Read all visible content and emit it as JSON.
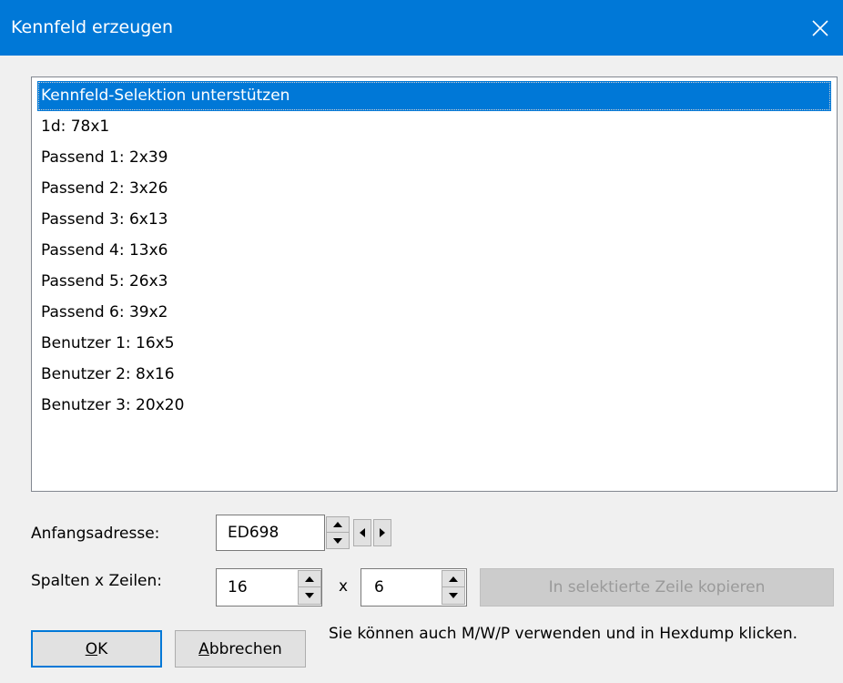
{
  "window": {
    "title": "Kennfeld erzeugen",
    "close_icon": "close-icon"
  },
  "list": {
    "items": [
      "Kennfeld-Selektion unterstützen",
      "1d: 78x1",
      "Passend 1: 2x39",
      "Passend 2: 3x26",
      "Passend 3: 6x13",
      "Passend 4: 13x6",
      "Passend 5: 26x3",
      "Passend 6: 39x2",
      "Benutzer 1: 16x5",
      "Benutzer 2: 8x16",
      "Benutzer 3: 20x20"
    ],
    "selected_index": 0
  },
  "start_address": {
    "label": "Anfangsadresse:",
    "value": "ED698"
  },
  "dimensions": {
    "label": "Spalten x Zeilen:",
    "columns": "16",
    "separator": "x",
    "rows": "6",
    "copy_button": "In selektierte Zeile kopieren"
  },
  "buttons": {
    "ok_underlined": "O",
    "ok_rest": "K",
    "cancel_underlined": "A",
    "cancel_rest": "bbrechen"
  },
  "hint": "Sie können auch M/W/P verwenden und in Hexdump klicken.",
  "colors": {
    "accent": "#0078d7",
    "dialog_bg": "#f0f0f0",
    "disabled_text": "#9a9a9a"
  }
}
